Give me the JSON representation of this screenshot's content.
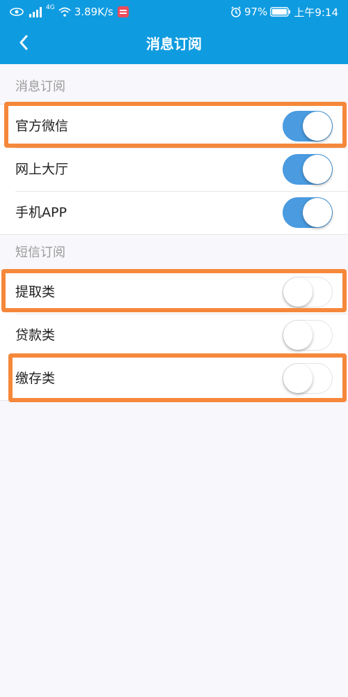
{
  "status_bar": {
    "network": "4G",
    "speed": "3.89K/s",
    "battery": "97%",
    "time": "上午9:14"
  },
  "header": {
    "title": "消息订阅"
  },
  "sections": [
    {
      "title": "消息订阅",
      "items": [
        {
          "label": "官方微信",
          "on": true
        },
        {
          "label": "网上大厅",
          "on": true
        },
        {
          "label": "手机APP",
          "on": true
        }
      ]
    },
    {
      "title": "短信订阅",
      "items": [
        {
          "label": "提取类",
          "on": false
        },
        {
          "label": "贷款类",
          "on": false
        },
        {
          "label": "缴存类",
          "on": false
        }
      ]
    }
  ],
  "colors": {
    "header_bg": "#0f9be0",
    "toggle_on": "#4a9be0",
    "highlight": "#f5883b"
  }
}
